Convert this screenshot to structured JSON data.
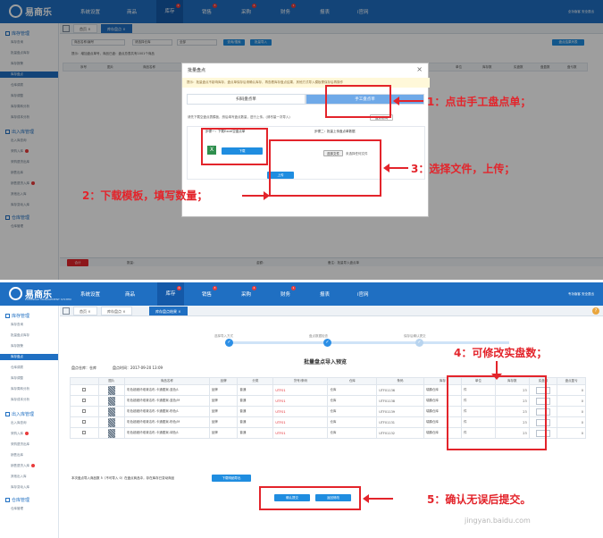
{
  "app": {
    "logo_text": "易商乐",
    "logo_sub": "ESHANGLE MANAGEMENT SYSTEM"
  },
  "nav": [
    {
      "label": "系统设置",
      "badge": ""
    },
    {
      "label": "商品",
      "badge": ""
    },
    {
      "label": "库存",
      "badge": "2"
    },
    {
      "label": "销售",
      "badge": "3"
    },
    {
      "label": "采购",
      "badge": "4"
    },
    {
      "label": "财务",
      "badge": "1"
    },
    {
      "label": "报表",
      "badge": ""
    },
    {
      "label": "i官网",
      "badge": ""
    }
  ],
  "nav_right": {
    "p1": "全功版客   安全退出",
    "p2": "专功版客   安全退出"
  },
  "sidebar": {
    "sec1": "库存管理",
    "items1": [
      "库存查询",
      "批量盘点库存",
      "库存报警",
      "库存盘点",
      "仓库调拨",
      "库存调整",
      "库存周转分析",
      "库存成本分析"
    ],
    "sec2": "出入库管理",
    "items2": [
      "出入库查询",
      "采购入库",
      "采购退货出库",
      "销售出库",
      "销售退货入库",
      "其他出入库",
      "库存变动入库"
    ],
    "sec3": "仓库管理",
    "items3": [
      "仓库管理"
    ]
  },
  "tabs1": [
    "首页 ×",
    "库存盘点 ×"
  ],
  "tabs2": [
    "首页 ×",
    "库存盘点 ×",
    "库存盘点结果 ×"
  ],
  "p1": {
    "search_ph": "商品名称/编号",
    "warehouse": "请选择仓库",
    "status": "全部",
    "btn_query": "查询/搜索",
    "btn_export": "批量导入",
    "btn_right": "盘点结果列表",
    "hint": "提示：增加盘点单号，商品已盘：盘点总表共有1001个商品",
    "cols": [
      "序号",
      "图片",
      "商品名称",
      "单位",
      "库存数",
      "实盘数",
      "盘盈数",
      "盘亏数"
    ],
    "total_label": "合计",
    "footer_a": "数量：",
    "footer_b": "金额：",
    "footer_c": "备注：批量导入盘点单"
  },
  "modal": {
    "title": "批量盘点",
    "close": "×",
    "tip": "提示：批量盘点不影响库存，盘点单保存后请确认库存，再查看库存盘点结果，其他方式导入模板需保存后再操作",
    "tab_scan": "扫码盘点单",
    "tab_manual": "手工盘点单",
    "instruction": "请先下载空盘点表模板，然后填写盘点数量，进行上传。(请尽量一次导入)",
    "instr_btn": "盘点说明",
    "step1": "步骤一：下载Excel空盘点单",
    "step2": "步骤二：批量上传盘点单数据",
    "btn_download": "下载",
    "btn_choose": "选择文件",
    "no_file": "未选择任何文件",
    "btn_upload": "上传"
  },
  "annotations": {
    "a1": "1：点击手工盘点单；",
    "a2": "2：下载模板，填写数量；",
    "a3": "3：选择文件，上传；",
    "a4": "4：可修改实盘数；",
    "a5": "5：确认无误后提交。"
  },
  "p2": {
    "steps": [
      "选择导入方式",
      "盘点数据检查",
      "保存后确认提交"
    ],
    "title": "批量盘点导入预览",
    "warehouse_label": "盘点仓库：仓库",
    "time_label": "盘点时间：2017-09-20 13:09",
    "cols": [
      "",
      "图片",
      "商品名称",
      "品牌",
      "分类",
      "货号/条码",
      "仓库",
      "条码",
      "库存",
      "单位",
      "库存数",
      "实盘数",
      "盘点盈亏"
    ],
    "rows": [
      {
        "name": "彩色超细纤维清洁布-卡通图案-蓝色/L",
        "brand": "品牌",
        "cat": "普通",
        "code": "UTF01",
        "wh": "仓库",
        "bar": "UTF01136",
        "stk": "瑞鹏仓库",
        "unit": "件",
        "qty": "23",
        "diff": "0"
      },
      {
        "name": "彩色超细纤维清洁布-卡通图案-蓝色/M",
        "brand": "品牌",
        "cat": "普通",
        "code": "UTF01",
        "wh": "仓库",
        "bar": "UTF01138",
        "stk": "瑞鹏仓库",
        "unit": "件",
        "qty": "23",
        "diff": "0"
      },
      {
        "name": "彩色超细纤维清洁布-卡通图案-粉色/L",
        "brand": "品牌",
        "cat": "普通",
        "code": "UTF01",
        "wh": "仓库",
        "bar": "UTF01139",
        "stk": "瑞鹏仓库",
        "unit": "件",
        "qty": "23",
        "diff": "0"
      },
      {
        "name": "彩色超细纤维清洁布-卡通图案-粉色/M",
        "brand": "品牌",
        "cat": "普通",
        "code": "UTF01",
        "wh": "仓库",
        "bar": "UTF01131",
        "stk": "瑞鹏仓库",
        "unit": "件",
        "qty": "23",
        "diff": "0"
      },
      {
        "name": "彩色超细纤维清洁布-卡通图案-绿色/L",
        "brand": "品牌",
        "cat": "普通",
        "code": "UTF01",
        "wh": "仓库",
        "bar": "UTF01132",
        "stk": "瑞鹏仓库",
        "unit": "件",
        "qty": "23",
        "diff": "0"
      }
    ],
    "summary": "本次盘点导入商品数 5（不可导入 0）在盘点商品中，存在库存已变动商品",
    "btn_dl_report": "下载明细导出",
    "btn_submit": "确认提交",
    "btn_back": "返回修改"
  },
  "watermark": "jingyan.baidu.com",
  "colors": {
    "brand": "#1f6fc2",
    "annotation": "#e3242b"
  }
}
